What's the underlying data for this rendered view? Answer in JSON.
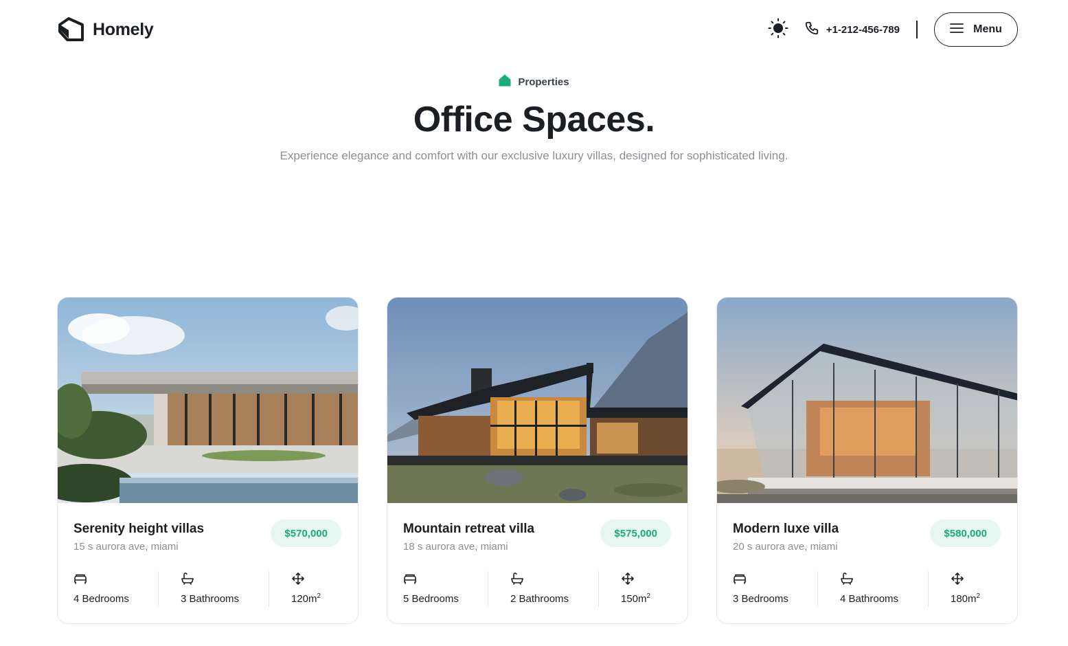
{
  "header": {
    "brand": "Homely",
    "phone": "+1-212-456-789",
    "menu_label": "Menu",
    "icons": {
      "logo": "house-logo-icon",
      "theme": "sun-icon",
      "phone": "phone-icon",
      "menu": "hamburger-icon"
    }
  },
  "hero": {
    "eyebrow": "Properties",
    "title": "Office Spaces.",
    "subtitle": "Experience elegance and comfort with our exclusive luxury villas, designed for sophisticated living."
  },
  "colors": {
    "accent": "#1faa7d",
    "price_bg": "#e6f7f1",
    "text": "#1b1f24",
    "muted": "#8a8f95"
  },
  "cards": [
    {
      "name": "Serenity height villas",
      "address": "15 s aurora ave, miami",
      "price": "$570,000",
      "bedrooms": "4 Bedrooms",
      "bathrooms": "3 Bathrooms",
      "area": "120m",
      "area_unit_exp": "2"
    },
    {
      "name": "Mountain retreat villa",
      "address": "18 s aurora ave, miami",
      "price": "$575,000",
      "bedrooms": "5 Bedrooms",
      "bathrooms": "2 Bathrooms",
      "area": "150m",
      "area_unit_exp": "2"
    },
    {
      "name": "Modern luxe villa",
      "address": "20 s aurora ave, miami",
      "price": "$580,000",
      "bedrooms": "3 Bedrooms",
      "bathrooms": "4 Bathrooms",
      "area": "180m",
      "area_unit_exp": "2"
    }
  ]
}
